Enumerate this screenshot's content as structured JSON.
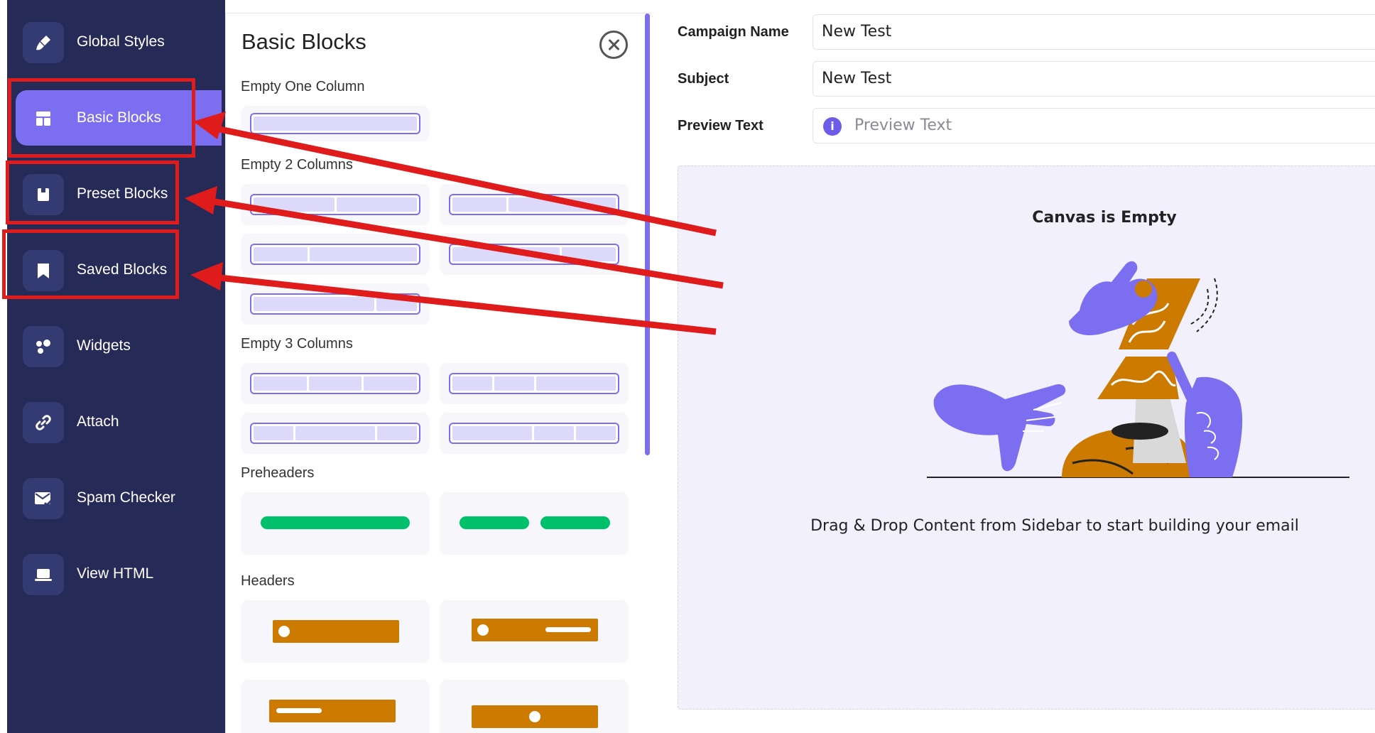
{
  "sidebar": {
    "items": [
      {
        "label": "Global Styles",
        "icon": "brush-icon"
      },
      {
        "label": "Basic Blocks",
        "icon": "layout-icon",
        "active": true
      },
      {
        "label": "Preset Blocks",
        "icon": "box-icon"
      },
      {
        "label": "Saved Blocks",
        "icon": "bookmark-icon"
      },
      {
        "label": "Widgets",
        "icon": "widgets-icon"
      },
      {
        "label": "Attach",
        "icon": "link-icon"
      },
      {
        "label": "Spam Checker",
        "icon": "mail-check-icon"
      },
      {
        "label": "View HTML",
        "icon": "laptop-icon"
      }
    ]
  },
  "panel": {
    "title": "Basic Blocks",
    "sections": {
      "one_column": "Empty One Column",
      "two_columns": "Empty 2 Columns",
      "three_columns": "Empty 3 Columns",
      "preheaders": "Preheaders",
      "headers": "Headers"
    }
  },
  "form": {
    "campaign_name_label": "Campaign Name",
    "campaign_name_value": "New Test",
    "subject_label": "Subject",
    "subject_value": "New Test",
    "preview_text_label": "Preview Text",
    "preview_text_placeholder": "Preview Text"
  },
  "canvas": {
    "title": "Canvas is Empty",
    "subtitle": "Drag & Drop Content from Sidebar to start building your email"
  },
  "colors": {
    "sidebar_bg": "#262a57",
    "accent": "#7c6ef0",
    "highlight_red": "#e01b1b",
    "preheader_green": "#00c06b",
    "header_orange": "#cc7a00"
  }
}
